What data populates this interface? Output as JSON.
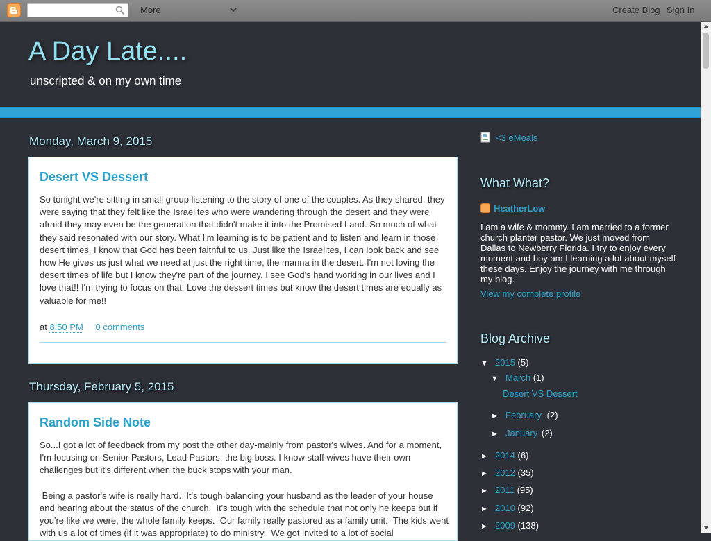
{
  "navbar": {
    "more_label": "More",
    "create_blog": "Create Blog",
    "sign_in": "Sign In"
  },
  "header": {
    "title": "A Day Late....",
    "description": "unscripted & on my own time"
  },
  "posts": [
    {
      "date": "Monday, March 9, 2015",
      "title": "Desert VS Dessert",
      "body": [
        "So tonight we're sitting in small group listening to the story of one of the couples.  As they shared, they were saying that they felt like the Israelites who were wandering through the desert and they were afraid they may even be the generation that didn't make it into the Promised Land. So much of what they said resonated with our story. What I'm learning is to be patient and to listen and learn in those desert times. I know that God has been faithful to us. Just like the Israelites, I can look back and see how He gives us just what we need at just the right time, the manna in the desert. I'm not loving the desert times of life but I know they're part of the journey. I see God's hand working in our lives and I love that!! I'm trying to focus on that. Love the dessert times but know the desert times are equally as valuable for me!!"
      ],
      "footer_at": "at",
      "time": "8:50 PM",
      "comments": "0 comments"
    },
    {
      "date": "Thursday, February 5, 2015",
      "title": "Random Side Note",
      "body": [
        "So...I got a lot of feedback from my post the other day-mainly from pastor's wives. And for a moment, I'm focusing on Senior Pastors, Lead Pastors, the big boss. I know staff wives have their own challenges but it's different when the buck stops with your man.",
        " Being a pastor's wife is really hard.  It's tough balancing your husband as the leader of your house and hearing about the status of the church.  It's tough with the schedule that not only he keeps but if you're like we were, the whole family keeps.  Our family really pastored as a family unit.  The kids went with us a lot of times (if it was appropriate) to do ministry.  We got invited to a lot of social"
      ]
    }
  ],
  "sidebar": {
    "emeals_label": "<3 eMeals",
    "about": {
      "title": "What What?",
      "name": "HeatherLow",
      "description": "I am a wife & mommy. I am married to a former church planter pastor. We just moved from Dallas to Newberry Florida. I try to enjoy every moment and boy am I learning a lot about myself these days. Enjoy the journey with me through my blog.",
      "profile_link": "View my complete profile"
    },
    "archive": {
      "title": "Blog Archive",
      "years": [
        {
          "year": "2015",
          "count": "(5)",
          "expanded": "▼"
        },
        {
          "year": "2014",
          "count": "(6)",
          "expanded": "►"
        },
        {
          "year": "2012",
          "count": "(35)",
          "expanded": "►"
        },
        {
          "year": "2011",
          "count": "(95)",
          "expanded": "►"
        },
        {
          "year": "2010",
          "count": "(92)",
          "expanded": "►"
        },
        {
          "year": "2009",
          "count": "(138)",
          "expanded": "►"
        }
      ],
      "months": [
        {
          "month": "March",
          "count": "(1)",
          "expanded": "▼"
        },
        {
          "month": "February",
          "count": "(2)",
          "expanded": "►"
        },
        {
          "month": "January",
          "count": "(2)",
          "expanded": "►"
        }
      ],
      "march_post": "Desert VS Dessert"
    }
  },
  "colors": {
    "background": "#2d3037",
    "accent": "#2aa0c9",
    "title": "#93e0f2",
    "tab_bar": "#2fa4d8"
  }
}
